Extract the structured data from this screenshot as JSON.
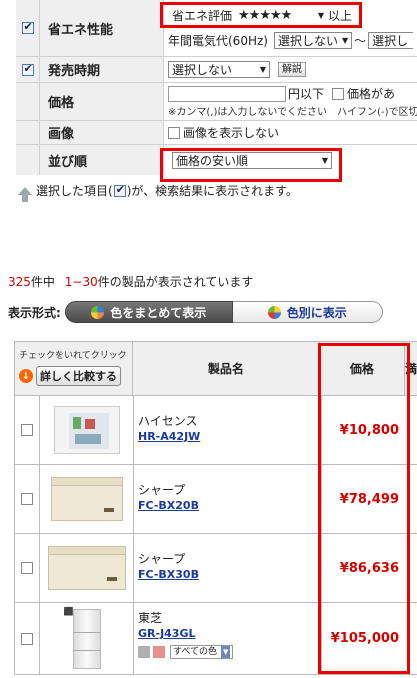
{
  "filters": {
    "energy": {
      "label": "省エネ性能",
      "rating_label": "省エネ評価",
      "rating_value": "★★★★★",
      "rating_suffix": "以上",
      "annual_label": "年間電気代(60Hz)",
      "annual_from": "選択しない",
      "annual_sep": "〜",
      "annual_to": "選択し"
    },
    "release": {
      "label": "発売時期",
      "value": "選択しない",
      "button": "解説"
    },
    "price": {
      "label": "価格",
      "suffix": "円以下",
      "checkbox_label": "価格があ",
      "note": "※カンマ(,)は入力しないでください　ハイフン(-)で区切"
    },
    "image": {
      "label": "画像",
      "checkbox_label": "画像を表示しない"
    },
    "sort": {
      "label": "並び順",
      "value": "価格の安い順"
    }
  },
  "note": {
    "text_before": "選択した項目(",
    "text_after": ")が、検索結果に表示されます。"
  },
  "results": {
    "total": "325",
    "total_suffix": "件中",
    "range": "1−30",
    "range_suffix": "件の製品が表示されています"
  },
  "display_mode": {
    "label": "表示形式:",
    "option_a": "色をまとめて表示",
    "option_b": "色別に表示"
  },
  "table": {
    "compare_hint": "チェックをいれてクリック",
    "compare_button": "詳しく比較する",
    "col_name": "製品名",
    "col_price": "価格",
    "col_more": "満"
  },
  "products": [
    {
      "maker": "ハイセンス",
      "model": "HR-A42JW",
      "price": "¥10,800",
      "image": "mini-fridge-icon"
    },
    {
      "maker": "シャープ",
      "model": "FC-BX20B",
      "price": "¥78,499",
      "image": "chest-freezer-icon"
    },
    {
      "maker": "シャープ",
      "model": "FC-BX30B",
      "price": "¥86,636",
      "image": "chest-freezer-icon"
    },
    {
      "maker": "東芝",
      "model": "GR-J43GL",
      "price": "¥105,000",
      "image": "tall-fridge-icon",
      "all_colors": "すべての色",
      "swatch_colors": [
        "#b0b0b0",
        "#e89090"
      ]
    }
  ],
  "colors": {
    "highlight": "#ee0000",
    "price": "#d40000",
    "link": "#1a3a9c"
  }
}
